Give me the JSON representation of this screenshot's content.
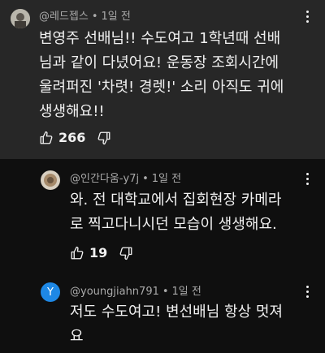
{
  "comments": [
    {
      "author": "@레드젭스",
      "time": "1일 전",
      "text_lines": [
        "변영주 선배님!! 수도여고 1학년때 선배",
        "님과 같이 다녔어요! 운동장 조회시간에",
        "울려퍼진 '차렷! 경렛!' 소리 아직도 귀에",
        "생생해요!!"
      ],
      "likes": "266"
    },
    {
      "author": "@인간다움-y7j",
      "time": "1일 전",
      "text_lines": [
        "와. 전 대학교에서 집회현장 카메라",
        "로 찍고다니시던 모습이 생생해요."
      ],
      "likes": "19"
    },
    {
      "author": "@youngjiahn791",
      "avatar_letter": "Y",
      "avatar_color": "#1e88e5",
      "time": "1일 전",
      "text_lines": [
        "저도 수도여고! 변선배님 항상 멋져",
        "요"
      ]
    }
  ]
}
